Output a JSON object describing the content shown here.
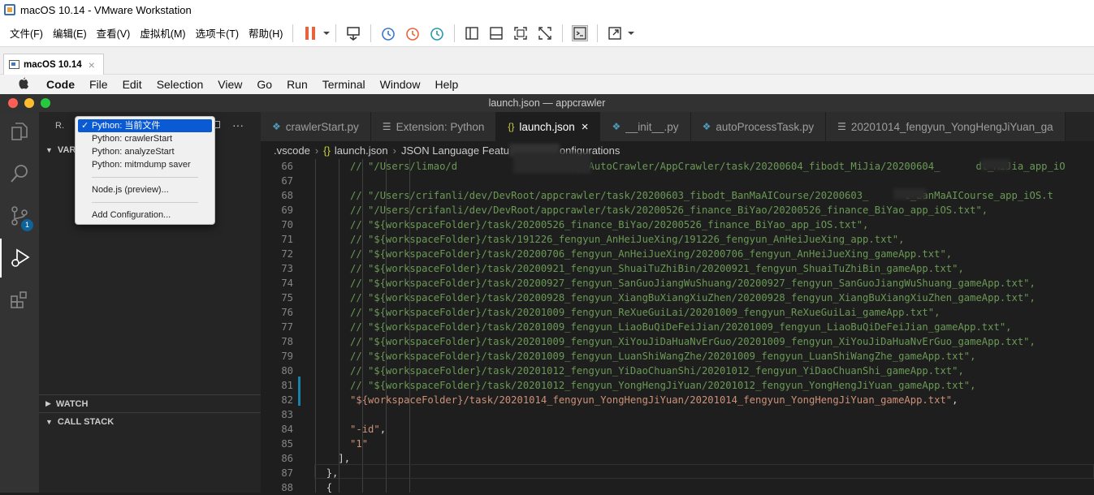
{
  "vm_window": {
    "title": "macOS 10.14 - VMware Workstation",
    "menu": [
      "文件(F)",
      "编辑(E)",
      "查看(V)",
      "虚拟机(M)",
      "选项卡(T)",
      "帮助(H)"
    ],
    "tab_label": "macOS 10.14",
    "tab_close": "×"
  },
  "mac_menu": {
    "apple": "",
    "items": [
      "Code",
      "File",
      "Edit",
      "Selection",
      "View",
      "Go",
      "Run",
      "Terminal",
      "Window",
      "Help"
    ]
  },
  "code_window": {
    "title": "launch.json — appcrawler"
  },
  "sidebar": {
    "run_label": "R.",
    "more": "···",
    "variables_header": "VAR",
    "watch_header": "WATCH",
    "callstack_header": "CALL STACK",
    "badge_count": "1"
  },
  "debug_config_dropdown": {
    "check": "✓",
    "items": [
      {
        "label": "Python: 当前文件",
        "selected": true
      },
      {
        "label": "Python: crawlerStart",
        "selected": false
      },
      {
        "label": "Python: analyzeStart",
        "selected": false
      },
      {
        "label": "Python: mitmdump saver",
        "selected": false
      }
    ],
    "node_label": "Node.js (preview)...",
    "add_label": "Add Configuration..."
  },
  "editor_tabs": [
    {
      "label": "crawlerStart.py",
      "icon": "python-icon",
      "active": false
    },
    {
      "label": "Extension: Python",
      "icon": "extension-list-icon",
      "active": false
    },
    {
      "label": "launch.json",
      "icon": "json-braces-icon",
      "active": true
    },
    {
      "label": "__init__.py",
      "icon": "python-icon",
      "active": false
    },
    {
      "label": "autoProcessTask.py",
      "icon": "python-icon",
      "active": false
    },
    {
      "label": "20201014_fengyun_YongHengJiYuan_ga",
      "icon": "text-file-icon",
      "active": false
    }
  ],
  "active_tab_close": "×",
  "breadcrumb": {
    "folder": ".vscode",
    "sep": "›",
    "file_icon": "{}",
    "file": "launch.json",
    "node_part1": "JSON Language Featu",
    "node_part2": "onfigurations"
  },
  "code_lines": [
    {
      "n": "66",
      "indent": "      ",
      "type": "comment",
      "text": "// \"/Users/limao/d              rler/appAutoCrawler/AppCrawler/task/20200604_fibodt_MiJia/20200604_      dt_MiJia_app_iO"
    },
    {
      "n": "67",
      "indent": "",
      "type": "blank",
      "text": ""
    },
    {
      "n": "68",
      "indent": "      ",
      "type": "comment",
      "text": "// \"/Users/crifanli/dev/DevRoot/appcrawler/task/20200603_fibodt_BanMaAICourse/20200603_      t_BanMaAICourse_app_iOS.t"
    },
    {
      "n": "69",
      "indent": "      ",
      "type": "comment",
      "text": "// \"/Users/crifanli/dev/DevRoot/appcrawler/task/20200526_finance_BiYao/20200526_finance_BiYao_app_iOS.txt\","
    },
    {
      "n": "70",
      "indent": "      ",
      "type": "comment",
      "text": "// \"${workspaceFolder}/task/20200526_finance_BiYao/20200526_finance_BiYao_app_iOS.txt\","
    },
    {
      "n": "71",
      "indent": "      ",
      "type": "comment",
      "text": "// \"${workspaceFolder}/task/191226_fengyun_AnHeiJueXing/191226_fengyun_AnHeiJueXing_app.txt\","
    },
    {
      "n": "72",
      "indent": "      ",
      "type": "comment",
      "text": "// \"${workspaceFolder}/task/20200706_fengyun_AnHeiJueXing/20200706_fengyun_AnHeiJueXing_gameApp.txt\","
    },
    {
      "n": "73",
      "indent": "      ",
      "type": "comment",
      "text": "// \"${workspaceFolder}/task/20200921_fengyun_ShuaiTuZhiBin/20200921_fengyun_ShuaiTuZhiBin_gameApp.txt\","
    },
    {
      "n": "74",
      "indent": "      ",
      "type": "comment",
      "text": "// \"${workspaceFolder}/task/20200927_fengyun_SanGuoJiangWuShuang/20200927_fengyun_SanGuoJiangWuShuang_gameApp.txt\","
    },
    {
      "n": "75",
      "indent": "      ",
      "type": "comment",
      "text": "// \"${workspaceFolder}/task/20200928_fengyun_XiangBuXiangXiuZhen/20200928_fengyun_XiangBuXiangXiuZhen_gameApp.txt\","
    },
    {
      "n": "76",
      "indent": "      ",
      "type": "comment",
      "text": "// \"${workspaceFolder}/task/20201009_fengyun_ReXueGuiLai/20201009_fengyun_ReXueGuiLai_gameApp.txt\","
    },
    {
      "n": "77",
      "indent": "      ",
      "type": "comment",
      "text": "// \"${workspaceFolder}/task/20201009_fengyun_LiaoBuQiDeFeiJian/20201009_fengyun_LiaoBuQiDeFeiJian_gameApp.txt\","
    },
    {
      "n": "78",
      "indent": "      ",
      "type": "comment",
      "text": "// \"${workspaceFolder}/task/20201009_fengyun_XiYouJiDaHuaNvErGuo/20201009_fengyun_XiYouJiDaHuaNvErGuo_gameApp.txt\","
    },
    {
      "n": "79",
      "indent": "      ",
      "type": "comment",
      "text": "// \"${workspaceFolder}/task/20201009_fengyun_LuanShiWangZhe/20201009_fengyun_LuanShiWangZhe_gameApp.txt\","
    },
    {
      "n": "80",
      "indent": "      ",
      "type": "comment",
      "text": "// \"${workspaceFolder}/task/20201012_fengyun_YiDaoChuanShi/20201012_fengyun_YiDaoChuanShi_gameApp.txt\","
    },
    {
      "n": "81",
      "indent": "      ",
      "type": "comment",
      "text": "// \"${workspaceFolder}/task/20201012_fengyun_YongHengJiYuan/20201012_fengyun_YongHengJiYuan_gameApp.txt\","
    },
    {
      "n": "82",
      "indent": "      ",
      "type": "string",
      "text": "\"${workspaceFolder}/task/20201014_fengyun_YongHengJiYuan/20201014_fengyun_YongHengJiYuan_gameApp.txt\"",
      "tail": ","
    },
    {
      "n": "83",
      "indent": "",
      "type": "blank",
      "text": ""
    },
    {
      "n": "84",
      "indent": "      ",
      "type": "string",
      "text": "\"-id\"",
      "tail": ","
    },
    {
      "n": "85",
      "indent": "      ",
      "type": "string",
      "text": "\"1\"",
      "tail": ""
    },
    {
      "n": "86",
      "indent": "    ",
      "type": "punct",
      "text": "],"
    },
    {
      "n": "87",
      "indent": "  ",
      "type": "punct",
      "text": "},"
    },
    {
      "n": "88",
      "indent": "  ",
      "type": "punct",
      "text": "{"
    }
  ],
  "colors": {
    "comment": "#6a9955",
    "string": "#ce9178",
    "accent_blue": "#0a5ad4",
    "pause_orange": "#e8643c"
  }
}
